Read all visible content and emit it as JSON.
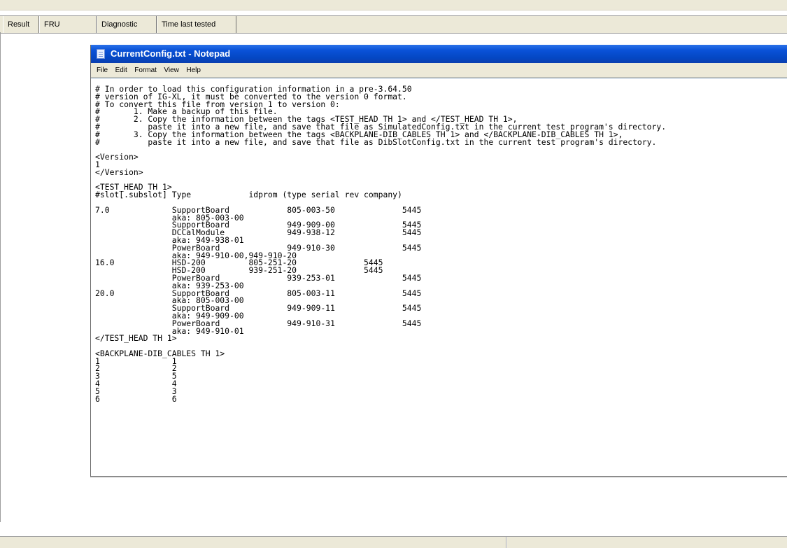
{
  "table_header": {
    "columns": [
      "Result",
      "FRU",
      "Diagnostic",
      "Time last tested"
    ]
  },
  "notepad": {
    "title": "CurrentConfig.txt - Notepad",
    "menu": [
      "File",
      "Edit",
      "Format",
      "View",
      "Help"
    ],
    "content": "# In order to load this configuration information in a pre-3.64.50\n# version of IG-XL, it must be converted to the version 0 format.\n# To convert this file from version 1 to version 0:\n#       1. Make a backup of this file.\n#       2. Copy the information between the tags <TEST_HEAD TH 1> and </TEST_HEAD TH 1>,\n#          paste it into a new file, and save that file as SimulatedConfig.txt in the current test program's directory.\n#       3. Copy the information between the tags <BACKPLANE-DIB_CABLES TH 1> and </BACKPLANE-DIB_CABLES TH 1>,\n#          paste it into a new file, and save that file as DibSlotConfig.txt in the current test program's directory.\n\n<Version>\n1\n</Version>\n\n<TEST_HEAD TH 1>\n#slot[.subslot] Type            idprom (type serial rev company)\n\n7.0             SupportBoard            805-003-50              5445\n                aka: 805-003-00\n                SupportBoard            949-909-00              5445\n                DCCalModule             949-938-12              5445\n                aka: 949-938-01\n                PowerBoard              949-910-30              5445\n                aka: 949-910-00,949-910-20\n16.0            HSD-200         805-251-20              5445\n                HSD-200         939-251-20              5445\n                PowerBoard              939-253-01              5445\n                aka: 939-253-00\n20.0            SupportBoard            805-003-11              5445\n                aka: 805-003-00\n                SupportBoard            949-909-11              5445\n                aka: 949-909-00\n                PowerBoard              949-910-31              5445\n                aka: 949-910-01\n</TEST_HEAD TH 1>\n\n<BACKPLANE-DIB_CABLES TH 1>\n1               1\n2               2\n3               5\n4               4\n5               3\n6               6"
  }
}
